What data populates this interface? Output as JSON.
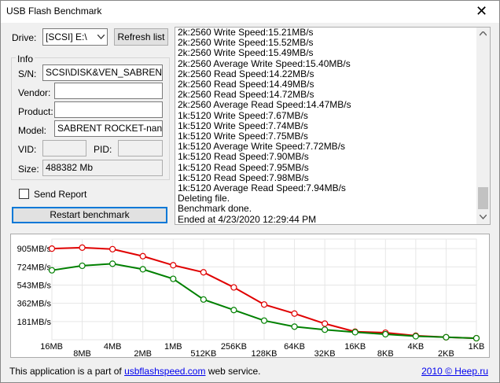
{
  "window": {
    "title": "USB Flash Benchmark",
    "close_glyph": "✕"
  },
  "drive": {
    "label": "Drive:",
    "selected": "[SCSI] E:\\",
    "refresh_label": "Refresh list"
  },
  "info": {
    "legend": "Info",
    "sn_label": "S/N:",
    "sn_value": "SCSI\\DISK&VEN_SABRENT&I",
    "vendor_label": "Vendor:",
    "vendor_value": "",
    "product_label": "Product:",
    "product_value": "",
    "model_label": "Model:",
    "model_value": "SABRENT ROCKET-nano S",
    "vid_label": "VID:",
    "vid_value": "",
    "pid_label": "PID:",
    "pid_value": "",
    "size_label": "Size:",
    "size_value": "488382 Mb"
  },
  "send_report": {
    "label": "Send Report",
    "checked": false
  },
  "restart_label": "Restart benchmark",
  "log": [
    "2k:2560 Write Speed:15.21MB/s",
    "2k:2560 Write Speed:15.52MB/s",
    "2k:2560 Write Speed:15.49MB/s",
    "2k:2560 Average Write Speed:15.40MB/s",
    "2k:2560 Read Speed:14.22MB/s",
    "2k:2560 Read Speed:14.49MB/s",
    "2k:2560 Read Speed:14.72MB/s",
    "2k:2560 Average Read Speed:14.47MB/s",
    "1k:5120 Write Speed:7.67MB/s",
    "1k:5120 Write Speed:7.74MB/s",
    "1k:5120 Write Speed:7.75MB/s",
    "1k:5120 Average Write Speed:7.72MB/s",
    "1k:5120 Read Speed:7.90MB/s",
    "1k:5120 Read Speed:7.95MB/s",
    "1k:5120 Read Speed:7.98MB/s",
    "1k:5120 Average Read Speed:7.94MB/s",
    "Deleting file.",
    "Benchmark done.",
    "Ended at 4/23/2020 12:29:44 PM"
  ],
  "chart_data": {
    "type": "line",
    "categories": [
      "16MB",
      "8MB",
      "4MB",
      "2MB",
      "1MB",
      "512KB",
      "256KB",
      "128KB",
      "64KB",
      "32KB",
      "16KB",
      "8KB",
      "4KB",
      "2KB",
      "1KB"
    ],
    "y_tick_labels": [
      "905MB/s",
      "724MB/s",
      "543MB/s",
      "362MB/s",
      "181MB/s"
    ],
    "y_ticks": [
      905,
      724,
      543,
      362,
      181
    ],
    "ylim": [
      0,
      1000
    ],
    "grid": true,
    "series": [
      {
        "color": "#e00000",
        "values": [
          905,
          915,
          900,
          830,
          740,
          670,
          520,
          350,
          260,
          160,
          80,
          70,
          40,
          25,
          15
        ]
      },
      {
        "color": "#008000",
        "values": [
          690,
          735,
          755,
          700,
          605,
          400,
          295,
          190,
          130,
          100,
          75,
          55,
          35,
          25,
          15
        ]
      }
    ]
  },
  "footer": {
    "left_prefix": "This application is a part of ",
    "left_link": "usbflashspeed.com",
    "left_suffix": " web service.",
    "right_prefix": "2010",
    "right_suffix": " © Heep.ru"
  }
}
